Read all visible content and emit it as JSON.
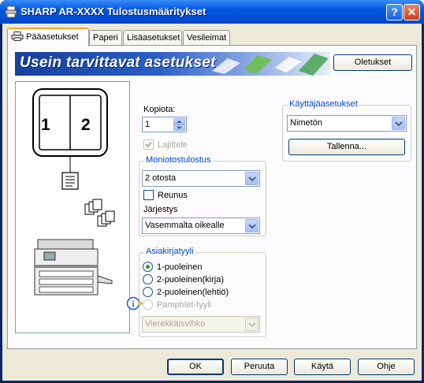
{
  "window": {
    "title": "SHARP AR-XXXX Tulostusmääritykset",
    "help_label": "?",
    "close_label": "✕"
  },
  "tabs": [
    {
      "label": "Pääasetukset"
    },
    {
      "label": "Paperi"
    },
    {
      "label": "Lisäasetukset"
    },
    {
      "label": "Vesileimat"
    }
  ],
  "banner": {
    "title": "Usein tarvittavat asetukset"
  },
  "defaults_button": "Oletukset",
  "preview": {
    "page_numbers": [
      "1",
      "2"
    ]
  },
  "copies": {
    "label": "Kopiota:",
    "value": "1"
  },
  "collate": {
    "label": "Lajittele",
    "checked": true,
    "enabled": false
  },
  "nup": {
    "title": "Moniotostulostus",
    "value": "2 otosta",
    "border_label": "Reunus",
    "border_checked": false,
    "order_label": "Järjestys",
    "order_value": "Vasemmalta oikealle"
  },
  "document_style": {
    "title": "Asiakirjatyyli",
    "options": [
      {
        "label": "1-puoleinen",
        "checked": true,
        "enabled": true
      },
      {
        "label": "2-puoleinen(kirja)",
        "checked": false,
        "enabled": true
      },
      {
        "label": "2-puoleinen(lehtiö)",
        "checked": false,
        "enabled": true
      },
      {
        "label": "Pamphlet-tyyli",
        "checked": false,
        "enabled": false
      }
    ],
    "pamphlet_value": "Vierekkäisvihko"
  },
  "user_settings": {
    "title": "Käyttäjäasetukset",
    "value": "Nimetön",
    "save_label": "Tallenna..."
  },
  "footer": {
    "ok": "OK",
    "cancel": "Peruuta",
    "apply": "Käytä",
    "help": "Ohje"
  },
  "colors": {
    "titlebar": "#0058e6",
    "group_title": "#0046d5",
    "banner": "#17409b"
  }
}
